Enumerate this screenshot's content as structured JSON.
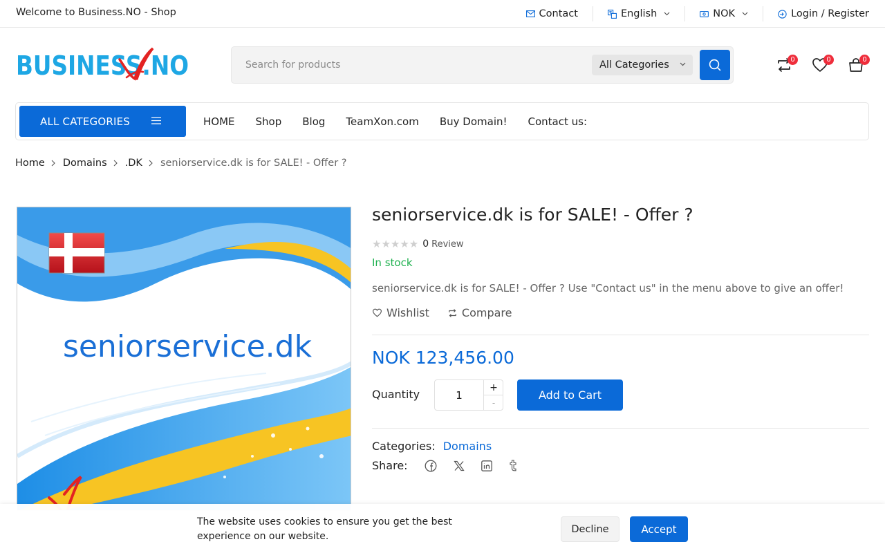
{
  "topbar": {
    "welcome": "Welcome to Business.NO - Shop",
    "contact": "Contact",
    "language": "English",
    "currency": "NOK",
    "login": "Login / Register"
  },
  "header": {
    "logo_alt": "BUSINESS.NO",
    "search_placeholder": "Search for products",
    "category_select": "All Categories",
    "compare_count": "0",
    "wishlist_count": "0",
    "cart_count": "0"
  },
  "nav": {
    "all_categories": "ALL CATEGORIES",
    "links": [
      "HOME",
      "Shop",
      "Blog",
      "TeamXon.com",
      "Buy Domain!",
      "Contact us:"
    ]
  },
  "breadcrumb": [
    "Home",
    "Domains",
    ".DK",
    "seniorservice.dk is for SALE! - Offer ?"
  ],
  "product": {
    "image_text": "seniorservice.dk",
    "title": "seniorservice.dk is for SALE! - Offer ?",
    "rating": 0,
    "review_count": "0",
    "review_label": "Review",
    "stock": "In stock",
    "description": "seniorservice.dk is for SALE! - Offer ? Use \"Contact us\" in the menu above to give an offer!",
    "wishlist_label": "Wishlist",
    "compare_label": "Compare",
    "price": "NOK 123,456.00",
    "quantity_label": "Quantity",
    "quantity_value": "1",
    "plus": "+",
    "minus": "-",
    "add_to_cart": "Add to Cart",
    "categories_label": "Categories:",
    "category": "Domains",
    "share_label": "Share:"
  },
  "cookie": {
    "message": "The website uses cookies to ensure you get the best experience on our website.",
    "decline": "Decline",
    "accept": "Accept"
  },
  "colors": {
    "primary": "#0b6ad8",
    "badge": "#ef2d3b",
    "stock": "#1fb14f",
    "logo_blue": "#1ea7e4",
    "logo_red": "#e32322"
  }
}
